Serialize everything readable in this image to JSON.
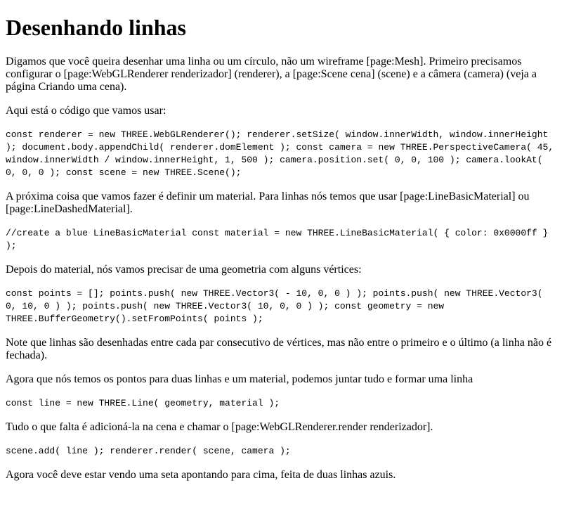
{
  "title": "Desenhando linhas",
  "blocks": {
    "p1": "Digamos que você queira desenhar uma linha ou um círculo, não um wireframe [page:Mesh]. Primeiro precisamos configurar o [page:WebGLRenderer renderizador] (renderer), a [page:Scene cena] (scene) e a câmera (camera) (veja a página Criando uma cena).",
    "p2": "Aqui está o código que vamos usar:",
    "code1": "const renderer = new THREE.WebGLRenderer(); renderer.setSize( window.innerWidth, window.innerHeight ); document.body.appendChild( renderer.domElement ); const camera = new THREE.PerspectiveCamera( 45, window.innerWidth / window.innerHeight, 1, 500 ); camera.position.set( 0, 0, 100 ); camera.lookAt( 0, 0, 0 ); const scene = new THREE.Scene();",
    "p3": "A próxima coisa que vamos fazer é definir um material. Para linhas nós temos que usar [page:LineBasicMaterial] ou [page:LineDashedMaterial].",
    "code2": "//create a blue LineBasicMaterial const material = new THREE.LineBasicMaterial( { color: 0x0000ff } );",
    "p4": "Depois do material, nós vamos precisar de uma geometria com alguns vértices:",
    "code3": "const points = []; points.push( new THREE.Vector3( - 10, 0, 0 ) ); points.push( new THREE.Vector3( 0, 10, 0 ) ); points.push( new THREE.Vector3( 10, 0, 0 ) ); const geometry = new THREE.BufferGeometry().setFromPoints( points );",
    "p5": "Note que linhas são desenhadas entre cada par consecutivo de vértices, mas não entre o primeiro e o último (a linha não é fechada).",
    "p6": "Agora que nós temos os pontos para duas linhas e um material, podemos juntar tudo e formar uma linha",
    "code4": "const line = new THREE.Line( geometry, material );",
    "p7": "Tudo o que falta é adicioná-la na cena e chamar o [page:WebGLRenderer.render renderizador].",
    "code5": "scene.add( line ); renderer.render( scene, camera );",
    "p8": "Agora você deve estar vendo uma seta apontando para cima, feita de duas linhas azuis."
  }
}
